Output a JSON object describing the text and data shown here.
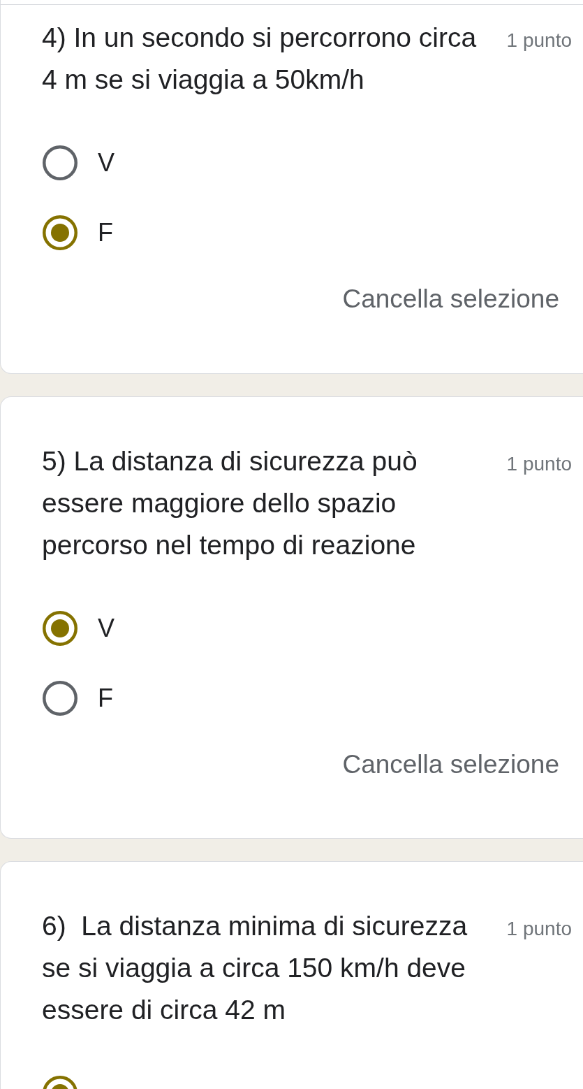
{
  "questions": [
    {
      "title": "4) In un secondo si percorrono circa 4 m se si viaggia a 50km/h",
      "points": "1 punto",
      "options": [
        {
          "label": "V",
          "selected": false
        },
        {
          "label": "F",
          "selected": true
        }
      ],
      "clear_button": "Cancella selezione"
    },
    {
      "title": "5) La distanza di sicurezza può essere maggiore dello spazio percorso nel tempo di reazione",
      "points": "1 punto",
      "options": [
        {
          "label": "V",
          "selected": true
        },
        {
          "label": "F",
          "selected": false
        }
      ],
      "clear_button": "Cancella selezione"
    },
    {
      "title": "6)  La distanza minima di sicurezza se si viaggia a circa 150 km/h deve essere di circa 42 m",
      "points": "1 punto",
      "options": [
        {
          "selected": true
        }
      ]
    }
  ]
}
